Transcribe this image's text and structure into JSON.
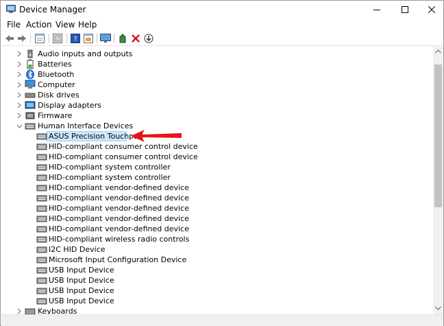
{
  "window": {
    "title": "Device Manager"
  },
  "menu": [
    "File",
    "Action",
    "View",
    "Help"
  ],
  "toolbar": {
    "icons": [
      "back-arrow-icon",
      "forward-arrow-icon",
      "properties-icon",
      "scan-icon",
      "help-icon",
      "view-icon",
      "monitor-icon",
      "add-driver-icon",
      "uninstall-x-icon",
      "update-download-icon"
    ]
  },
  "tree": {
    "categories_top": [
      {
        "label": "Audio inputs and outputs",
        "icon": "speaker-icon"
      },
      {
        "label": "Batteries",
        "icon": "battery-icon"
      },
      {
        "label": "Bluetooth",
        "icon": "bluetooth-icon"
      },
      {
        "label": "Computer",
        "icon": "computer-icon"
      },
      {
        "label": "Disk drives",
        "icon": "disk-drive-icon"
      },
      {
        "label": "Display adapters",
        "icon": "display-adapter-icon"
      },
      {
        "label": "Firmware",
        "icon": "firmware-icon"
      }
    ],
    "hid": {
      "label": "Human Interface Devices",
      "icon": "hid-icon",
      "devices": [
        "ASUS Precision Touchpad",
        "HID-compliant consumer control device",
        "HID-compliant consumer control device",
        "HID-compliant system controller",
        "HID-compliant system controller",
        "HID-compliant vendor-defined device",
        "HID-compliant vendor-defined device",
        "HID-compliant vendor-defined device",
        "HID-compliant vendor-defined device",
        "HID-compliant vendor-defined device",
        "HID-compliant wireless radio controls",
        "I2C HID Device",
        "Microsoft Input Configuration Device",
        "USB Input Device",
        "USB Input Device",
        "USB Input Device",
        "USB Input Device"
      ],
      "selected_device": "ASUS Precision Touchpad"
    },
    "categories_bottom": [
      {
        "label": "Keyboards",
        "icon": "keyboard-icon"
      }
    ]
  },
  "annotation": {
    "color": "#e8141b"
  },
  "colors": {
    "selection_bg": "#cce8ff",
    "selection_border": "#99d1ff"
  }
}
